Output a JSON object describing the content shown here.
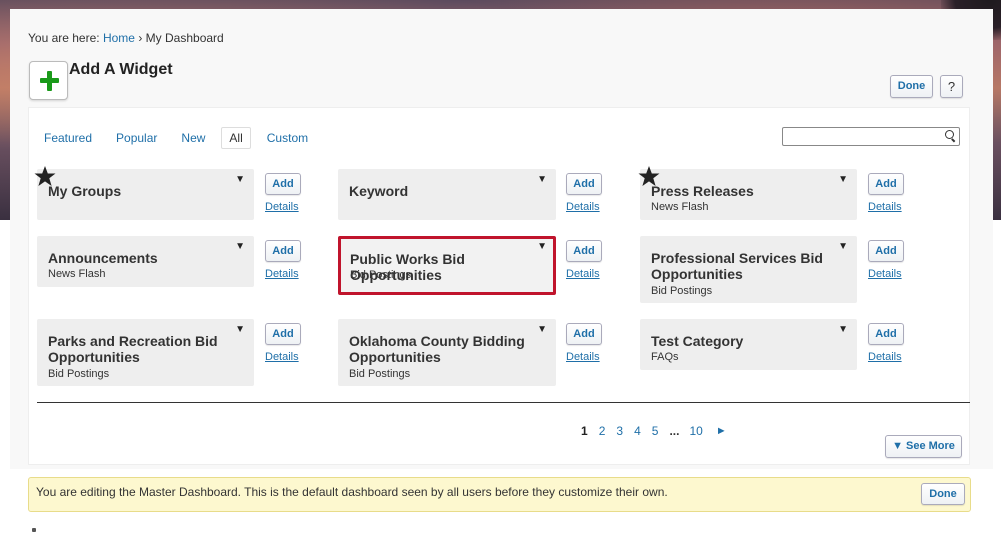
{
  "breadcrumb": {
    "prefix": "You are here:",
    "home": "Home",
    "separator": "›",
    "current": "My Dashboard"
  },
  "header": {
    "title": "Add A Widget",
    "done_label": "Done",
    "help_label": "?"
  },
  "filters": [
    "Featured",
    "Popular",
    "New",
    "All",
    "Custom"
  ],
  "active_filter": "All",
  "search": {
    "value": "",
    "placeholder": ""
  },
  "cards": [
    {
      "title": "My Groups",
      "subtitle": "",
      "starred": true
    },
    {
      "title": "Keyword",
      "subtitle": "",
      "starred": false
    },
    {
      "title": "Press Releases",
      "subtitle": "News Flash",
      "starred": true
    },
    {
      "title": "Announcements",
      "subtitle": "News Flash",
      "starred": false
    },
    {
      "title": "Public Works Bid Opportunities",
      "subtitle": "Bid Postings",
      "starred": false,
      "selected": true
    },
    {
      "title": "Professional Services Bid Opportunities",
      "subtitle": "Bid Postings",
      "starred": false
    },
    {
      "title": "Parks and Recreation Bid Opportunities",
      "subtitle": "Bid Postings",
      "starred": false
    },
    {
      "title": "Oklahoma County Bidding Opportunities",
      "subtitle": "Bid Postings",
      "starred": false
    },
    {
      "title": "Test Category",
      "subtitle": "FAQs",
      "starred": false
    }
  ],
  "card_actions": {
    "add_label": "Add",
    "details_label": "Details",
    "menu_glyph": "▼"
  },
  "pagination": {
    "pages": [
      "1",
      "2",
      "3",
      "4",
      "5"
    ],
    "ellipsis": "...",
    "last": "10",
    "current": "1",
    "next_glyph": "►"
  },
  "see_more": "▼ See More",
  "notice": {
    "text": "You are editing the Master Dashboard. This is the default dashboard seen by all users before they customize their own.",
    "done_label": "Done"
  },
  "colors": {
    "link": "#1f6fa8",
    "plus_icon": "#1a9a1a",
    "selected_border": "#c0142c",
    "notice_bg": "#fdf8cf"
  }
}
